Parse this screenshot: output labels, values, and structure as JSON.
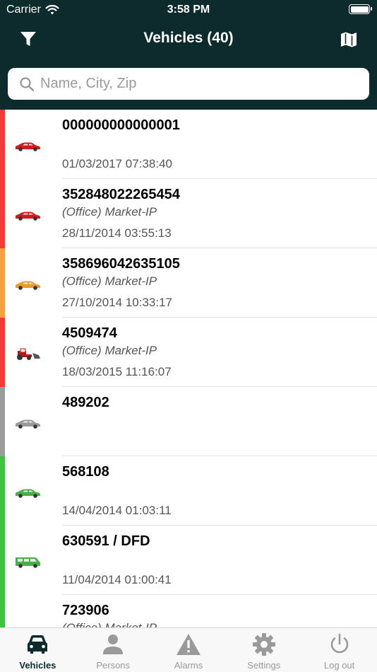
{
  "status_bar": {
    "carrier": "Carrier",
    "time": "3:58 PM"
  },
  "nav": {
    "title": "Vehicles (40)",
    "filter_icon": "filter-icon",
    "map_icon": "map-icon"
  },
  "search": {
    "placeholder": "Name, City, Zip"
  },
  "vehicles": [
    {
      "id": "000000000000001",
      "location": "",
      "timestamp": "01/03/2017 07:38:40",
      "status_color": "#f23a3a",
      "icon": "car-icon",
      "icon_color": "#d11a1a"
    },
    {
      "id": "352848022265454",
      "location": "(Office) Market-IP",
      "timestamp": "28/11/2014 03:55:13",
      "status_color": "#f23a3a",
      "icon": "car-icon",
      "icon_color": "#d11a1a"
    },
    {
      "id": "358696042635105",
      "location": "(Office) Market-IP",
      "timestamp": "27/10/2014 10:33:17",
      "status_color": "#f7a03c",
      "icon": "car-icon",
      "icon_color": "#e89a2c"
    },
    {
      "id": "4509474",
      "location": "(Office) Market-IP",
      "timestamp": "18/03/2015 11:16:07",
      "status_color": "#f23a3a",
      "icon": "tractor-icon",
      "icon_color": "#c41515"
    },
    {
      "id": "489202",
      "location": "",
      "timestamp": "",
      "status_color": "#9b9b9b",
      "icon": "car-icon",
      "icon_color": "#9a9a9a"
    },
    {
      "id": "568108",
      "location": "",
      "timestamp": "14/04/2014 01:03:11",
      "status_color": "#3cc23c",
      "icon": "car-icon",
      "icon_color": "#46b046"
    },
    {
      "id": "630591 / DFD",
      "location": "",
      "timestamp": "11/04/2014 01:00:41",
      "status_color": "#3cc23c",
      "icon": "van-icon",
      "icon_color": "#46b046"
    },
    {
      "id": "723906",
      "location": "(Office) Market-IP",
      "timestamp": "",
      "status_color": "#3cc23c",
      "icon": "car-icon",
      "icon_color": "#46b046"
    }
  ],
  "tabs": [
    {
      "label": "Vehicles",
      "icon": "car-icon",
      "active": true
    },
    {
      "label": "Persons",
      "icon": "person-icon",
      "active": false
    },
    {
      "label": "Alarms",
      "icon": "warning-icon",
      "active": false
    },
    {
      "label": "Settings",
      "icon": "gear-icon",
      "active": false
    },
    {
      "label": "Log out",
      "icon": "power-icon",
      "active": false
    }
  ],
  "colors": {
    "header_bg": "#0d2a2c",
    "tab_active": "#0d2a2c",
    "tab_inactive": "#9a9a9a"
  }
}
